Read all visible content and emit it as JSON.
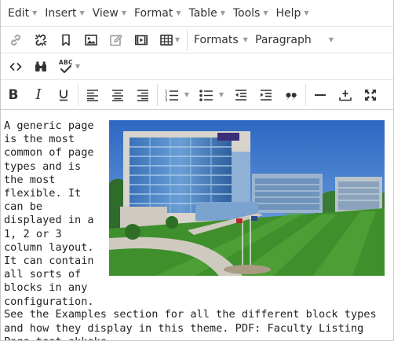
{
  "menubar": {
    "items": [
      {
        "label": "Edit"
      },
      {
        "label": "Insert"
      },
      {
        "label": "View"
      },
      {
        "label": "Format"
      },
      {
        "label": "Table"
      },
      {
        "label": "Tools"
      },
      {
        "label": "Help"
      }
    ]
  },
  "toolbar": {
    "formats_label": "Formats",
    "paragraph_label": "Paragraph",
    "icons": [
      "link-icon",
      "unlink-icon",
      "anchor-icon",
      "image-icon",
      "edit-image-icon",
      "media-icon",
      "table-icon",
      "code-icon",
      "find-replace-icon",
      "spellcheck-icon",
      "bold-icon",
      "italic-icon",
      "underline-icon",
      "align-left-icon",
      "align-center-icon",
      "align-right-icon",
      "numbered-list-icon",
      "bullet-list-icon",
      "outdent-icon",
      "indent-icon",
      "blockquote-icon",
      "horizontal-rule-icon",
      "insert-icon",
      "fullscreen-icon"
    ],
    "spellcheck_glyph": "ABC"
  },
  "content": {
    "paragraph1": "A generic page is the most common of page types and is the most flexible. It can be displayed in a 1, 2 or 3 column layout. It can contain all sorts of blocks in any configuration.",
    "paragraph2": "See the Examples section for all the different block types and how they display in this theme. PDF: Faculty Listing Page test ekkeke",
    "image_subject": "campus-building-photo"
  },
  "colors": {
    "icon": "#333333",
    "disabled_icon": "#9a9a9a",
    "border": "#c9c9c9",
    "sky": "#3a78c8",
    "lawn": "#3f8f2c"
  }
}
